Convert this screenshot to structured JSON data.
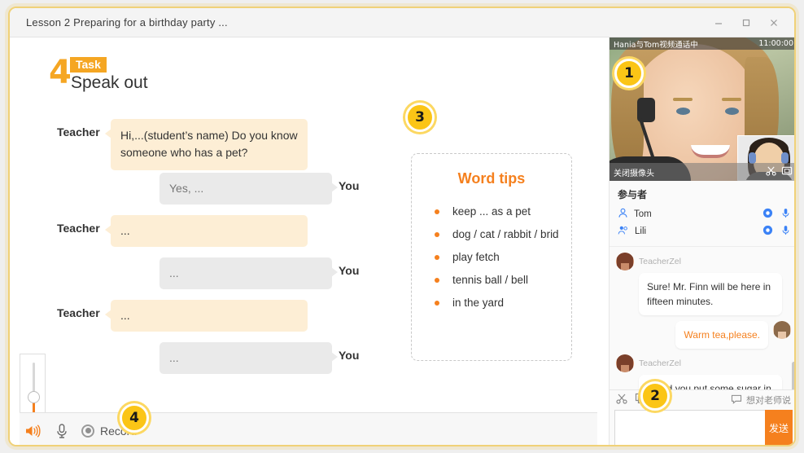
{
  "window": {
    "title": "Lesson 2  Preparing for a birthday party ...",
    "controls": {
      "minimize": "—",
      "maximize": "▢",
      "close": "✕"
    }
  },
  "task": {
    "number": "4",
    "badge_label": "Task",
    "subtitle": "Speak out"
  },
  "dialogue": [
    {
      "speaker": "Teacher",
      "side": "left",
      "text": "Hi,...(student’s name) Do you know someone who has a pet?"
    },
    {
      "speaker": "You",
      "side": "right",
      "text": "Yes, ..."
    },
    {
      "speaker": "Teacher",
      "side": "left",
      "text": "..."
    },
    {
      "speaker": "You",
      "side": "right",
      "text": "..."
    },
    {
      "speaker": "Teacher",
      "side": "left",
      "text": "..."
    },
    {
      "speaker": "You",
      "side": "right",
      "text": "..."
    }
  ],
  "word_tips": {
    "title": "Word tips",
    "items": [
      "keep ... as a pet",
      "dog / cat / rabbit / brid",
      "play fetch",
      "tennis ball / bell",
      "in the yard"
    ]
  },
  "badges": [
    {
      "id": "1",
      "label": "1"
    },
    {
      "id": "2",
      "label": "2"
    },
    {
      "id": "3",
      "label": "3"
    },
    {
      "id": "4",
      "label": "4"
    }
  ],
  "recorder": {
    "record_label": "Record",
    "volume_percent": 46
  },
  "video": {
    "title": "Hania与Tom视频通话中",
    "time": "11:00:00",
    "camera_off_label": "关闭摄像头"
  },
  "participants": {
    "title": "参与者",
    "list": [
      {
        "name": "Tom"
      },
      {
        "name": "Lili"
      }
    ]
  },
  "chat": {
    "messages": [
      {
        "author": "TeacherZel",
        "text": "Sure! Mr. Finn will be here in fifteen minutes.",
        "side": "left"
      },
      {
        "author": "",
        "text": "Warm tea,please.",
        "side": "right"
      },
      {
        "author": "TeacherZel",
        "text": "Could you put some sugar in it? Thank you!",
        "side": "left"
      }
    ],
    "input": {
      "value": "",
      "placeholder": ""
    },
    "send_label": "发送",
    "hint_label": "想对老师说"
  },
  "colors": {
    "accent_orange": "#f5801e",
    "badge_gold": "#fbc516",
    "teacher_bubble": "#fdeed5",
    "you_bubble": "#eaeaea",
    "frame_gold": "#f0d178",
    "participant_blue": "#3b82f6"
  }
}
